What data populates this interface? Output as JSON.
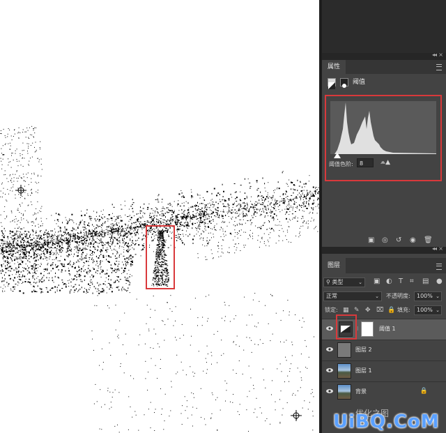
{
  "properties_panel": {
    "tab_label": "属性",
    "adjustment_name": "阈值",
    "threshold_label": "阈值色阶:",
    "threshold_value": "8",
    "warning_icon": "warning-icon"
  },
  "layers_panel": {
    "tab_label": "图层",
    "filter_kind": "类型",
    "blend_mode": "正常",
    "opacity_label": "不透明度:",
    "opacity_value": "100%",
    "lock_label": "锁定:",
    "fill_label": "填充:",
    "fill_value": "100%",
    "layers": [
      {
        "name": "阈值 1",
        "type": "adjustment",
        "selected": true
      },
      {
        "name": "图层 2",
        "type": "gray"
      },
      {
        "name": "图层 1",
        "type": "photo"
      },
      {
        "name": "背景",
        "type": "photo",
        "locked": true
      }
    ]
  },
  "watermark": {
    "main": "UiBQ.CoM",
    "sub": "优化之图"
  },
  "colors": {
    "highlight": "#d9393b",
    "panel_bg": "#434343",
    "canvas_bg": "#ffffff"
  }
}
